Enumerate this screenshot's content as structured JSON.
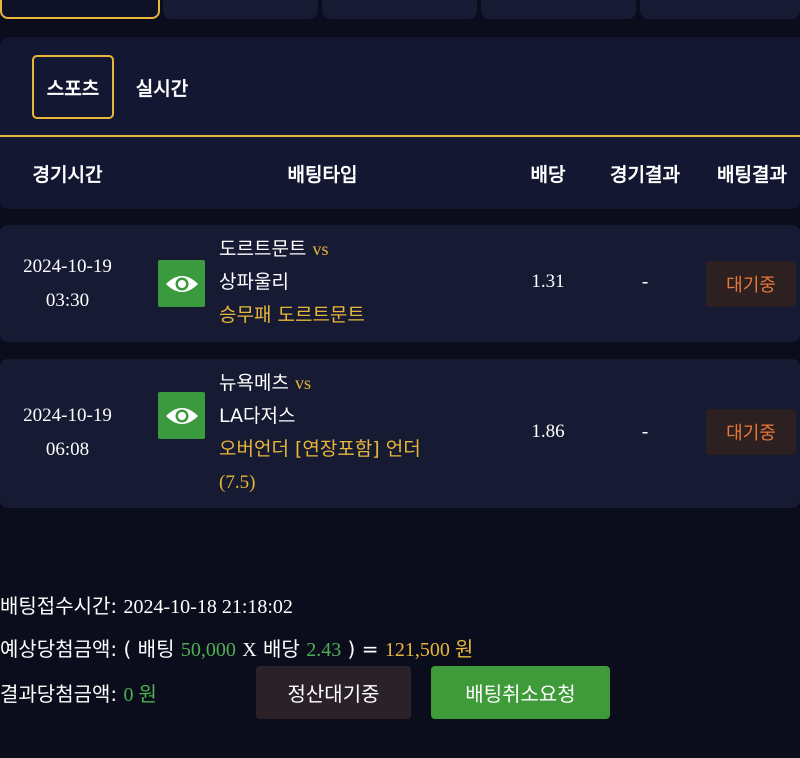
{
  "tabs": {
    "sports": "스포츠",
    "live": "실시간"
  },
  "table_headers": {
    "match_time": "경기시간",
    "bet_type": "배팅타입",
    "odds": "배당",
    "match_result": "경기결과",
    "bet_result": "배팅결과"
  },
  "bets": [
    {
      "date": "2024-10-19",
      "time": "03:30",
      "home": "도르트문트",
      "vs": "vs",
      "away": "상파울리",
      "pick_lines": [
        "승무패 도르트문트"
      ],
      "odds": "1.31",
      "match_result": "-",
      "status": "대기중"
    },
    {
      "date": "2024-10-19",
      "time": "06:08",
      "home": "뉴욕메츠",
      "vs": "vs",
      "away": "LA다저스",
      "pick_lines": [
        "오버언더 [연장포함] 언더",
        "(7.5)"
      ],
      "odds": "1.86",
      "match_result": "-",
      "status": "대기중"
    }
  ],
  "summary": {
    "receipt_label": "배팅접수시간:",
    "receipt_time": "2024-10-18 21:18:02",
    "expected_label": "예상당첨금액:",
    "open_paren": "(",
    "bet_word": "배팅",
    "bet_amount": "50,000",
    "times": "X",
    "odds_word": "배당",
    "total_odds": "2.43",
    "close_eq": ") =",
    "expected_amount": "121,500 원",
    "result_label": "결과당첨금액:",
    "result_amount": "0 원"
  },
  "buttons": {
    "settle_pending": "정산대기중",
    "cancel_request": "배팅취소요청"
  },
  "colors": {
    "accent_gold": "#e8b73a",
    "green": "#4caf50",
    "status_orange": "#e8773a",
    "background": "#0c0d1c"
  }
}
